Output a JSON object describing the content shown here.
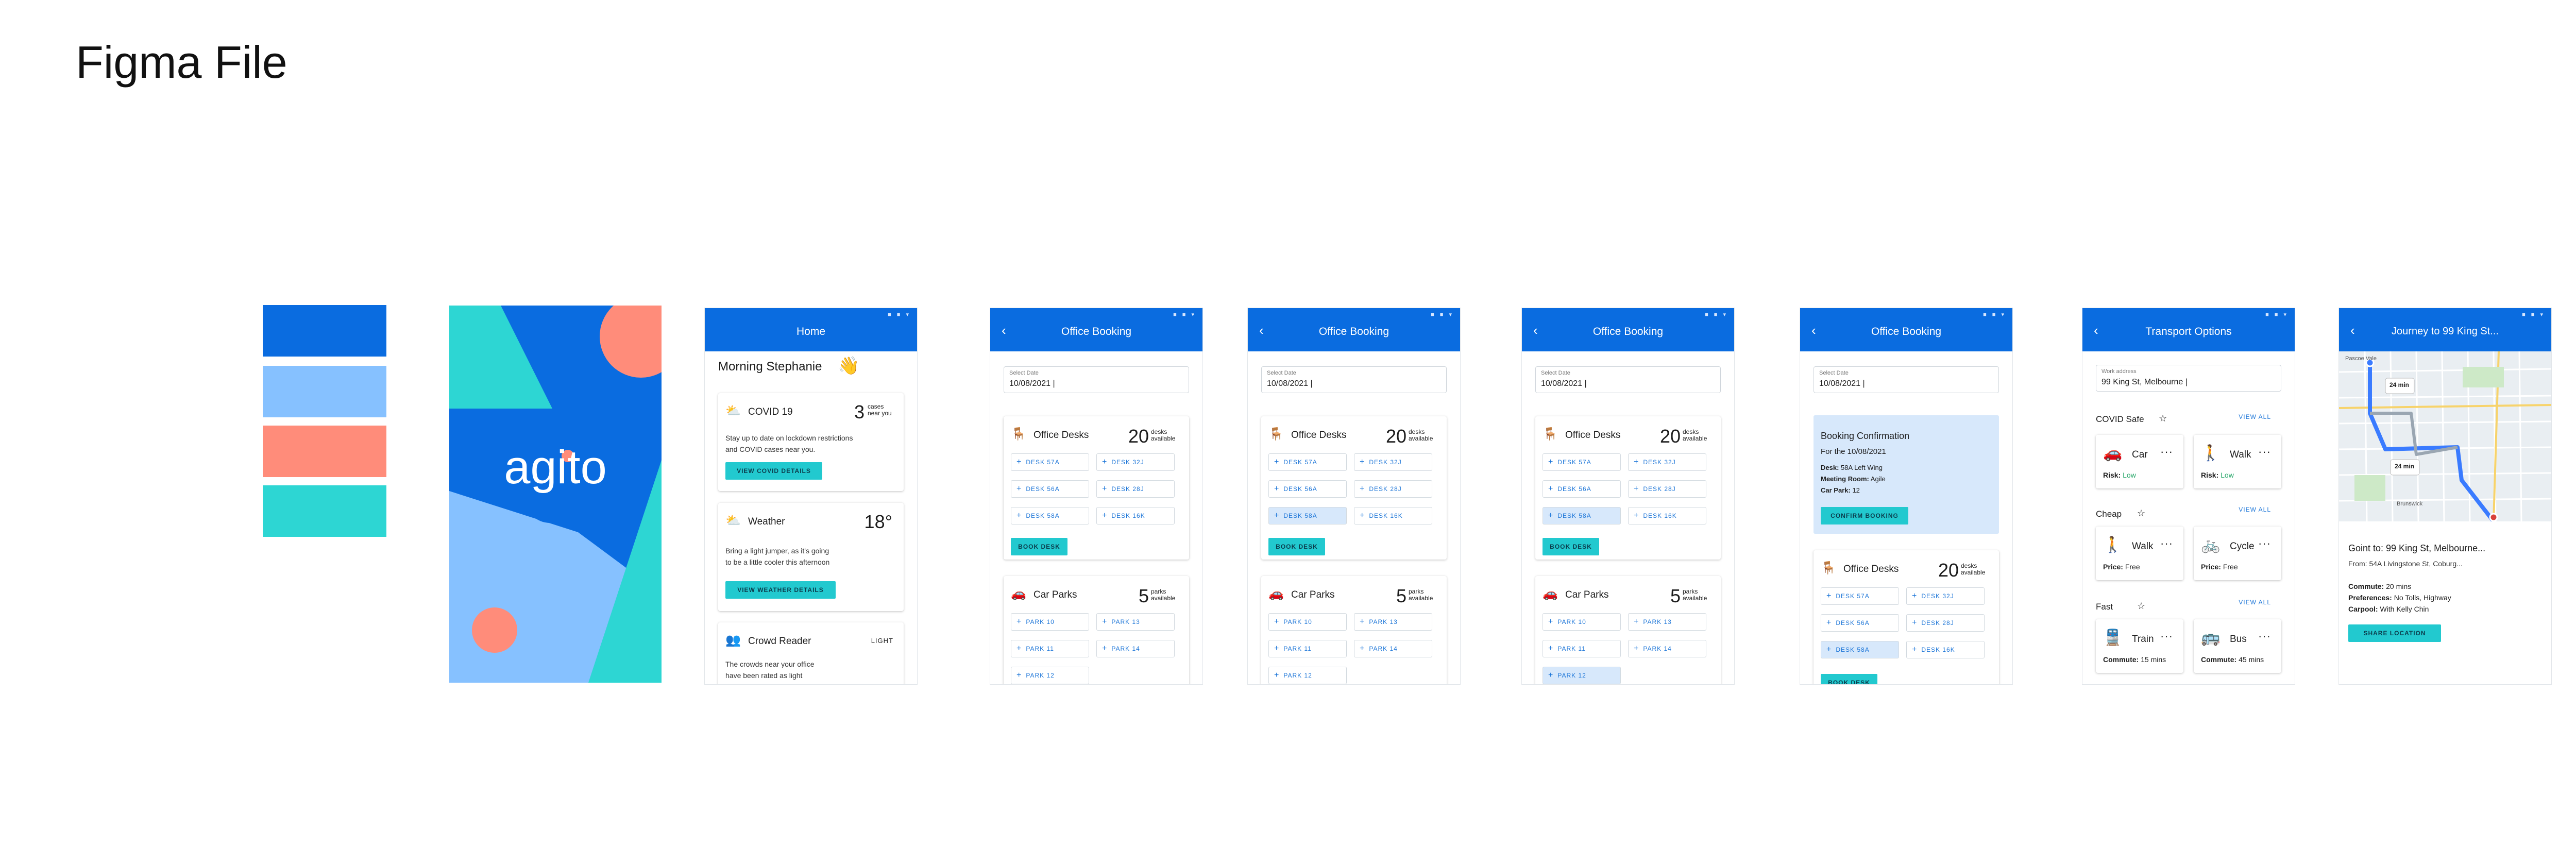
{
  "page": {
    "title": "Figma File"
  },
  "palette": [
    "#0a6ce0",
    "#86c1ff",
    "#ff8c7a",
    "#2dd6d3"
  ],
  "common": {
    "date_label": "Select Date",
    "date_value": "10/08/2021 |",
    "back": "‹",
    "status_dots": "■ ■ ▾"
  },
  "splash": {
    "logo": "agito"
  },
  "home": {
    "title": "Home",
    "greeting": "Morning Stephanie",
    "wave": "👋",
    "covid": {
      "title": "COVID 19",
      "count": "3",
      "count_label": "cases near you",
      "body1": "Stay up to date on lockdown restrictions",
      "body2": "and COVID cases near you.",
      "button": "VIEW COVID DETAILS"
    },
    "weather": {
      "title": "Weather",
      "temp": "18°",
      "body1": "Bring a light jumper, as it's going",
      "body2": "to be a little cooler this afternoon",
      "button": "VIEW WEATHER DETAILS"
    },
    "crowd": {
      "title": "Crowd Reader",
      "level": "LIGHT",
      "body1": "The crowds near your office",
      "body2": "have been rated as light"
    }
  },
  "booking": {
    "title": "Office Booking",
    "desks_title": "Office Desks",
    "desks_count": "20",
    "desks_label": "desks available",
    "desks": [
      "DESK 57A",
      "DESK 32J",
      "DESK 56A",
      "DESK 28J",
      "DESK 58A",
      "DESK 16K"
    ],
    "book_button": "BOOK DESK",
    "parks_title": "Car Parks",
    "parks_count": "5",
    "parks_label": "parks available",
    "parks": [
      "PARK 10",
      "PARK 13",
      "PARK 11",
      "PARK 14",
      "PARK 12"
    ]
  },
  "confirmation": {
    "heading": "Booking Confirmation",
    "for_date": "For the 10/08/2021",
    "desk_label": "Desk:",
    "desk_value": "58A Left Wing",
    "room_label": "Meeting Room:",
    "room_value": "Agile",
    "park_label": "Car Park:",
    "park_value": "12",
    "button": "CONFIRM BOOKING"
  },
  "transport": {
    "title": "Transport Options",
    "addr_label": "Work address",
    "addr_value": "99 King St, Melbourne |",
    "view_all": "VIEW ALL",
    "sections": [
      {
        "name": "COVID Safe",
        "items": [
          {
            "icon": "🚗",
            "name": "Car",
            "meta_label": "Risk:",
            "meta_value": "Low"
          },
          {
            "icon": "🚶",
            "name": "Walk",
            "meta_label": "Risk:",
            "meta_value": "Low"
          }
        ]
      },
      {
        "name": "Cheap",
        "items": [
          {
            "icon": "🚶",
            "name": "Walk",
            "meta_label": "Price:",
            "meta_value": "Free"
          },
          {
            "icon": "🚲",
            "name": "Cycle",
            "meta_label": "Price:",
            "meta_value": "Free"
          }
        ]
      },
      {
        "name": "Fast",
        "items": [
          {
            "icon": "🚆",
            "name": "Train",
            "meta_label": "Commute:",
            "meta_value": "15 mins"
          },
          {
            "icon": "🚌",
            "name": "Bus",
            "meta_label": "Commute:",
            "meta_value": "45 mins"
          }
        ]
      }
    ]
  },
  "journey": {
    "title": "Journey to 99 King St...",
    "goint": "Goint to: 99 King St, Melbourne...",
    "from": "From: 54A Livingstone St, Coburg...",
    "commute_label": "Commute:",
    "commute_value": "20 mins",
    "pref_label": "Preferences:",
    "pref_value": "No Tolls, Highway",
    "carpool_label": "Carpool:",
    "carpool_value": "With Kelly Chin",
    "button": "SHARE LOCATION",
    "map_bubble_1": "24 min",
    "map_bubble_2": "24 min",
    "map_place_1": "Pascoe Vale",
    "map_place_2": "Brunswick"
  }
}
